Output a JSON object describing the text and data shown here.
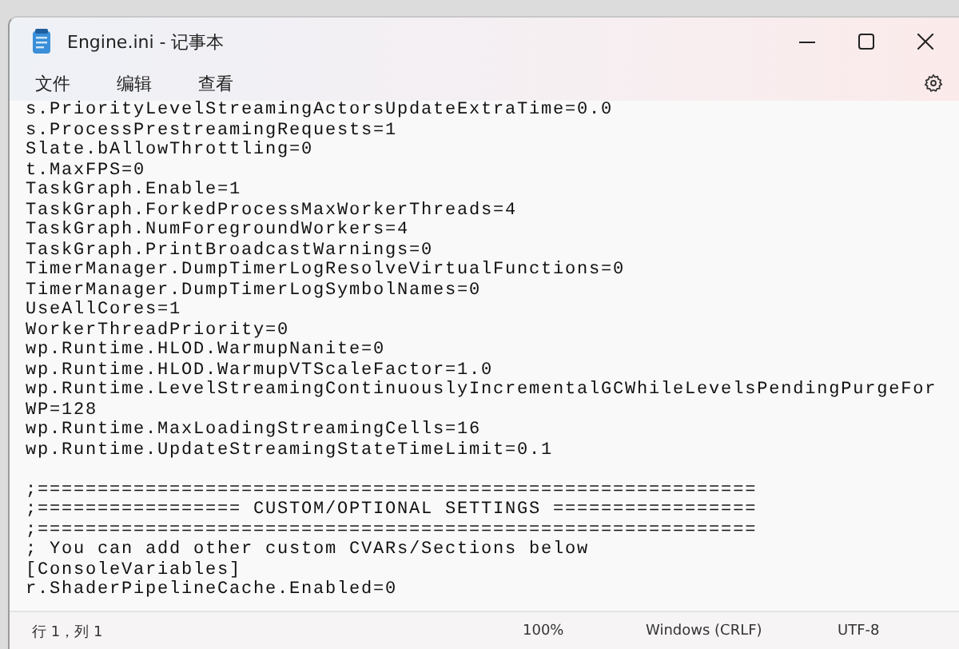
{
  "window": {
    "title": "Engine.ini - 记事本"
  },
  "menu": [
    "文件",
    "编辑",
    "查看"
  ],
  "editor": {
    "partial_line": "s.PriorityLevelStreamingActorsUpdateExtraTime=0.0",
    "blocks": [
      [
        "s.ProcessPrestreamingRequests=1",
        "Slate.bAllowThrottling=0",
        "t.MaxFPS=0",
        "TaskGraph.Enable=1",
        "TaskGraph.ForkedProcessMaxWorkerThreads=4",
        "TaskGraph.NumForegroundWorkers=4",
        "TaskGraph.PrintBroadcastWarnings=0",
        "TimerManager.DumpTimerLogResolveVirtualFunctions=0",
        "TimerManager.DumpTimerLogSymbolNames=0",
        "UseAllCores=1",
        "WorkerThreadPriority=0",
        "wp.Runtime.HLOD.WarmupNanite=0",
        "wp.Runtime.HLOD.WarmupVTScaleFactor=1.0",
        "wp.Runtime.LevelStreamingContinuouslyIncrementalGCWhileLevelsPendingPurgeFor",
        "WP=128",
        "wp.Runtime.MaxLoadingStreamingCells=16",
        "wp.Runtime.UpdateStreamingStateTimeLimit=0.1"
      ],
      [
        ";============================================================",
        ";================= CUSTOM/OPTIONAL SETTINGS =================",
        ";============================================================",
        "; You can add other custom CVARs/Sections below",
        "[ConsoleVariables]",
        "r.ShaderPipelineCache.Enabled=0"
      ]
    ]
  },
  "status_bar": {
    "position": "行 1，列 1",
    "zoom": "100%",
    "line_ending": "Windows (CRLF)",
    "encoding": "UTF-8"
  }
}
